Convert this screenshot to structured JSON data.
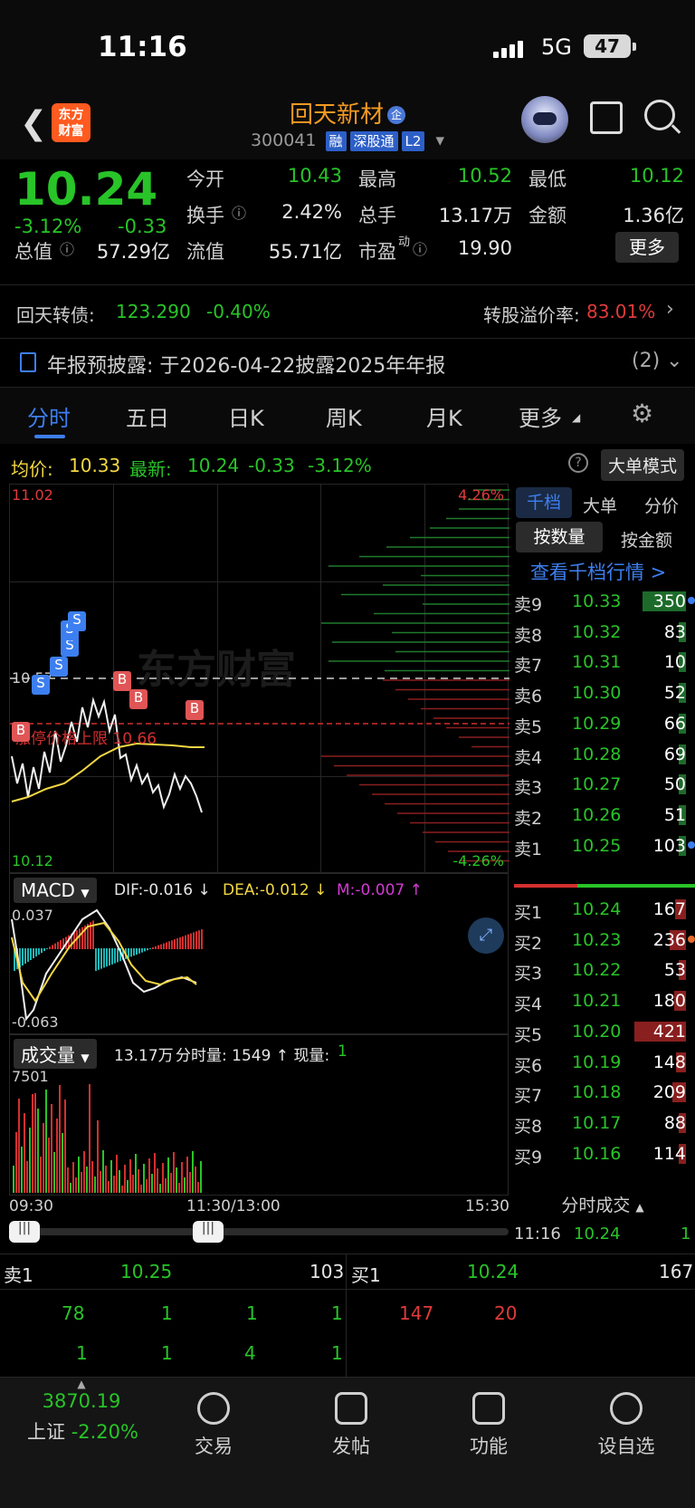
{
  "status_bar": {
    "time": "11:16",
    "network": "5G",
    "battery": "47"
  },
  "header": {
    "back_icon": "chevron-left-icon",
    "logo_text": "东方\n财富",
    "stock_name": "回天新材",
    "badge_qi": "企",
    "stock_code": "300041",
    "tags": [
      "融",
      "深股通",
      "L2"
    ],
    "actions": [
      "robot-assistant-icon",
      "share-icon",
      "search-icon"
    ]
  },
  "quote": {
    "price": "10.24",
    "change_pct": "-3.12%",
    "change": "-0.33",
    "fields": [
      {
        "label": "今开",
        "value": "10.43",
        "color": "#28c428"
      },
      {
        "label": "最高",
        "value": "10.52",
        "color": "#28c428"
      },
      {
        "label": "最低",
        "value": "10.12",
        "color": "#28c428"
      },
      {
        "label": "换手",
        "value": "2.42%",
        "color": "#e6e6e6"
      },
      {
        "label": "总手",
        "value": "13.17万",
        "color": "#e6e6e6"
      },
      {
        "label": "金额",
        "value": "1.36亿",
        "color": "#e6e6e6"
      },
      {
        "label": "总值",
        "value": "57.29亿",
        "color": "#e6e6e6"
      },
      {
        "label": "流值",
        "value": "55.71亿",
        "color": "#e6e6e6"
      },
      {
        "label": "市盈",
        "value": "19.90",
        "color": "#e6e6e6"
      }
    ],
    "pe_suffix": "动",
    "more_button": "更多"
  },
  "bond": {
    "name": "回天转债:",
    "price": "123.290",
    "pct": "-0.40%",
    "premium_label": "转股溢价率:",
    "premium_value": "83.01%"
  },
  "notice": {
    "text": "年报预披露:  于2026-04-22披露2025年年报",
    "count": "(2)"
  },
  "tabs": [
    "分时",
    "五日",
    "日K",
    "周K",
    "月K",
    "更多"
  ],
  "active_tab": "分时",
  "indicator": {
    "avg_label": "均价:",
    "avg_value": "10.33",
    "latest_label": "最新:",
    "latest_value": "10.24",
    "latest_change": "-0.33",
    "latest_pct": "-3.12%",
    "help": "?",
    "big_order_mode": "大单模式"
  },
  "chart": {
    "y_top": "11.02",
    "y_mid": "10.57",
    "y_bottom": "10.12",
    "pct_top": "4.26%",
    "pct_bottom": "-4.26%",
    "red_line_label": "涨停价格上限",
    "red_line_value": "10.66",
    "watermark": "东方财富",
    "macd_label": "MACD",
    "dif": "DIF:-0.016 ↓",
    "dea": "DEA:-0.012 ↓",
    "m": "M:-0.007 ↑",
    "macd_top": "0.037",
    "macd_bottom": "-0.063",
    "volume_label": "成交量",
    "volume_total": "13.17万",
    "volume_detail": "分时量: 1549 ↑ 现量:",
    "volume_now": "1",
    "volume_max": "7501",
    "time_labels": [
      "09:30",
      "11:30/13:00",
      "15:30"
    ]
  },
  "orderbook": {
    "tabs": [
      "千档",
      "大单",
      "分价"
    ],
    "subtabs": [
      "按数量",
      "按金额"
    ],
    "link": "查看千档行情 >",
    "asks": [
      {
        "label": "卖9",
        "price": "10.33",
        "qty": "350",
        "fill": 0.8
      },
      {
        "label": "卖8",
        "price": "10.32",
        "qty": "83",
        "fill": 0.05
      },
      {
        "label": "卖7",
        "price": "10.31",
        "qty": "10",
        "fill": 0.0
      },
      {
        "label": "卖6",
        "price": "10.30",
        "qty": "52",
        "fill": 0.04
      },
      {
        "label": "卖5",
        "price": "10.29",
        "qty": "66",
        "fill": 0.06
      },
      {
        "label": "卖4",
        "price": "10.28",
        "qty": "69",
        "fill": 0.06
      },
      {
        "label": "卖3",
        "price": "10.27",
        "qty": "50",
        "fill": 0.04
      },
      {
        "label": "卖2",
        "price": "10.26",
        "qty": "51",
        "fill": 0.04
      },
      {
        "label": "卖1",
        "price": "10.25",
        "qty": "103",
        "fill": 0.08
      }
    ],
    "bids": [
      {
        "label": "买1",
        "price": "10.24",
        "qty": "167",
        "fill": 0.2
      },
      {
        "label": "买2",
        "price": "10.23",
        "qty": "236",
        "fill": 0.3
      },
      {
        "label": "买3",
        "price": "10.22",
        "qty": "53",
        "fill": 0.05
      },
      {
        "label": "买4",
        "price": "10.21",
        "qty": "180",
        "fill": 0.22
      },
      {
        "label": "买5",
        "price": "10.20",
        "qty": "421",
        "fill": 0.95
      },
      {
        "label": "买6",
        "price": "10.19",
        "qty": "148",
        "fill": 0.18
      },
      {
        "label": "买7",
        "price": "10.18",
        "qty": "209",
        "fill": 0.25
      },
      {
        "label": "买8",
        "price": "10.17",
        "qty": "88",
        "fill": 0.08
      },
      {
        "label": "买9",
        "price": "10.16",
        "qty": "114",
        "fill": 0.12
      }
    ],
    "trades_label": "分时成交",
    "trade": {
      "time": "11:16",
      "price": "10.24",
      "qty": "1"
    }
  },
  "bottom_book": {
    "sell_label": "卖1",
    "sell_price": "10.25",
    "sell_qty": "103",
    "buy_label": "买1",
    "buy_price": "10.24",
    "buy_qty": "167",
    "sell_row1": [
      "78",
      "1",
      "1",
      "1"
    ],
    "sell_row2": [
      "1",
      "1",
      "4",
      "1"
    ],
    "buy_row1": [
      "147",
      "20"
    ]
  },
  "nav": {
    "index_value": "3870.19",
    "index_name": "上证",
    "index_pct": "-2.20%",
    "items": [
      {
        "label": "交易",
        "icon": "trade-yen-icon"
      },
      {
        "label": "发帖",
        "icon": "post-edit-icon"
      },
      {
        "label": "功能",
        "icon": "function-grid-icon"
      },
      {
        "label": "设自选",
        "icon": "add-watchlist-icon"
      }
    ]
  }
}
